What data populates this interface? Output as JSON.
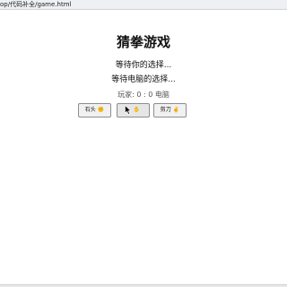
{
  "browser": {
    "url_fragment": "op/代码补全/game.html"
  },
  "game": {
    "title": "猜拳游戏",
    "player_choice_text": "等待你的选择...",
    "computer_choice_text": "等待电脑的选择...",
    "score_text": "玩家: 0 : 0 电脑"
  },
  "buttons": [
    {
      "label": "石头",
      "emoji": "✊"
    },
    {
      "label": "布",
      "emoji": "✋"
    },
    {
      "label": "剪刀",
      "emoji": "✌️"
    }
  ]
}
